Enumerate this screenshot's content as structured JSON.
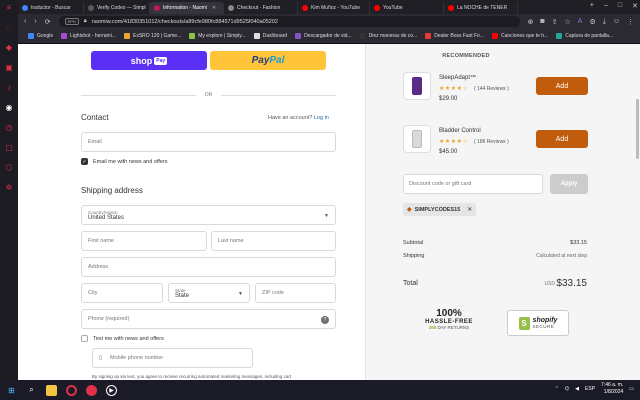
{
  "browser": {
    "tabs": [
      {
        "label": "traductor - Buscar",
        "color": "#4285f4",
        "active": false
      },
      {
        "label": "Verify Codes — Simpl",
        "color": "#5a5a5a",
        "active": false
      },
      {
        "label": "Information - Naomi",
        "color": "#c2185b",
        "active": true
      },
      {
        "label": "Checkout - Fashion",
        "color": "#888888",
        "active": false
      },
      {
        "label": "Kim Muñoz - YouTube",
        "color": "#ff0000",
        "active": false
      },
      {
        "label": "YouTube",
        "color": "#ff0000",
        "active": false
      },
      {
        "label": "La NOCHE de TENER",
        "color": "#ff0000",
        "active": false
      }
    ],
    "url": "naomiw.com/41830351012/checkouts/a89cfe980fc884571d9525f040a05202",
    "url_badge": "EPN",
    "bookmarks": [
      {
        "label": "Google",
        "color": "#4285f4"
      },
      {
        "label": "Lightshot - herrami...",
        "color": "#a64bd6"
      },
      {
        "label": "ExSRO 120 | Game...",
        "color": "#f0a030"
      },
      {
        "label": "My explore | Simply...",
        "color": "#8bc34a"
      },
      {
        "label": "Dashboard",
        "color": "#e0e0e0"
      },
      {
        "label": "Descargador de vid...",
        "color": "#7e57c2"
      },
      {
        "label": "Diez maneras de co...",
        "color": "#333333"
      },
      {
        "label": "Dealer Boss Fast Fo...",
        "color": "#e53935"
      },
      {
        "label": "Canciones que te h...",
        "color": "#ff0000"
      },
      {
        "label": "Captura de pantalla...",
        "color": "#26a69a"
      }
    ]
  },
  "checkout": {
    "shop_pay_label": "shop",
    "shop_pay_badge": "Pay",
    "paypal_label_a": "Pay",
    "paypal_label_b": "Pal",
    "or_label": "OR",
    "contact_heading": "Contact",
    "have_account": "Have an account?",
    "login_link": "Log in",
    "email_placeholder": "Email",
    "email_news_label": "Email me with news and offers",
    "shipping_heading": "Shipping address",
    "country_label": "Country/region",
    "country_value": "United States",
    "first_name_placeholder": "First name",
    "last_name_placeholder": "Last name",
    "address_placeholder": "Address",
    "city_placeholder": "City",
    "state_label": "State",
    "state_value": "State",
    "zip_placeholder": "ZIP code",
    "phone_placeholder": "Phone (required)",
    "text_news_label": "Text me with news and offers",
    "mobile_placeholder": "Mobile phone number",
    "sms_disclaimer": "By signing up via text, you agree to receive recurring automated marketing messages, including cart"
  },
  "summary": {
    "recommended_heading": "RECOMMENDED",
    "products": [
      {
        "name": "SleepAdapt™",
        "stars": "★★★★☆",
        "reviews": "( 144 Reviews )",
        "price": "$29.00",
        "button": "Add",
        "bottle_color": "#5b2a86"
      },
      {
        "name": "Bladder Control",
        "stars": "★★★★☆",
        "reviews": "( 186 Reviews )",
        "price": "$45.00",
        "button": "Add",
        "bottle_color": "#d9d9d9"
      }
    ],
    "discount_placeholder": "Discount code or gift card",
    "apply_label": "Apply",
    "applied_code": "SIMPLYCODES15",
    "subtotal_label": "Subtotal",
    "subtotal_value": "$33.15",
    "shipping_label": "Shipping",
    "shipping_value": "Calculated at next step",
    "total_label": "Total",
    "total_currency": "USD",
    "total_value": "$33.15",
    "guarantee_big": "100%",
    "guarantee_mid": "HASSLE-FREE",
    "guarantee_days": "365",
    "guarantee_small": "DAY RETURNS",
    "shopify_brand": "shopify",
    "shopify_secure": "SECURE"
  },
  "taskbar": {
    "lang": "ESP",
    "time": "7:46 a. m.",
    "date": "1/8/2024"
  },
  "colors": {
    "accent_add": "#c25c0d",
    "shop_pay": "#5a31f4",
    "paypal": "#ffc439",
    "sidebar_icons": "#e0314b"
  }
}
